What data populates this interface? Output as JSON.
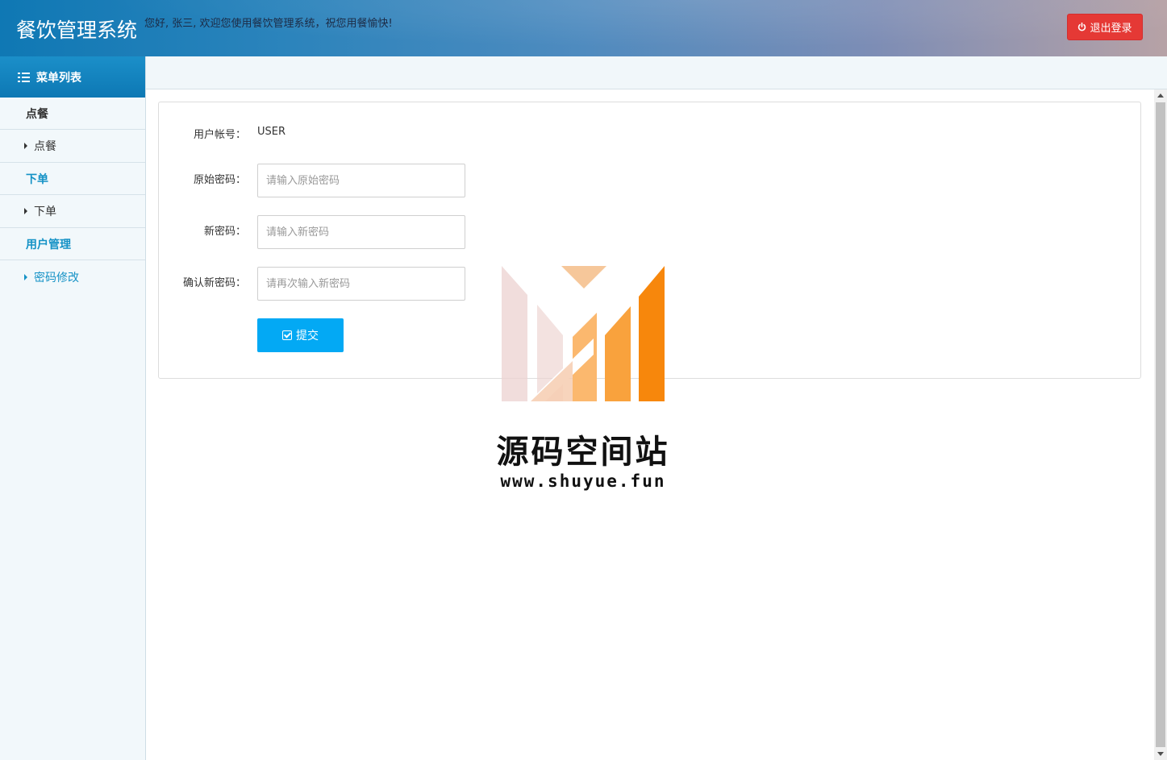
{
  "header": {
    "app_title": "餐饮管理系统",
    "welcome_text": "您好, 张三, 欢迎您使用餐饮管理系统，祝您用餐愉快!",
    "logout_label": "退出登录",
    "colors": {
      "logout_bg": "#e53935",
      "header_start": "#0f78b4",
      "header_end": "#b7a2a6"
    }
  },
  "sidebar": {
    "menu_title": "菜单列表",
    "groups": [
      {
        "label": "点餐",
        "items": [
          {
            "label": "点餐"
          }
        ]
      },
      {
        "label": "下单",
        "items": [
          {
            "label": "下单"
          }
        ]
      },
      {
        "label": "用户管理",
        "items": [
          {
            "label": "密码修改",
            "active": true
          }
        ]
      }
    ]
  },
  "form": {
    "account_label": "用户帐号：",
    "account_value": "USER",
    "old_password_label": "原始密码：",
    "old_password_placeholder": "请输入原始密码",
    "new_password_label": "新密码：",
    "new_password_placeholder": "请输入新密码",
    "confirm_password_label": "确认新密码：",
    "confirm_password_placeholder": "请再次输入新密码",
    "submit_label": "提交",
    "colors": {
      "submit_bg": "#03a9f4"
    }
  },
  "watermark": {
    "title": "源码空间站",
    "url": "www.shuyue.fun"
  }
}
